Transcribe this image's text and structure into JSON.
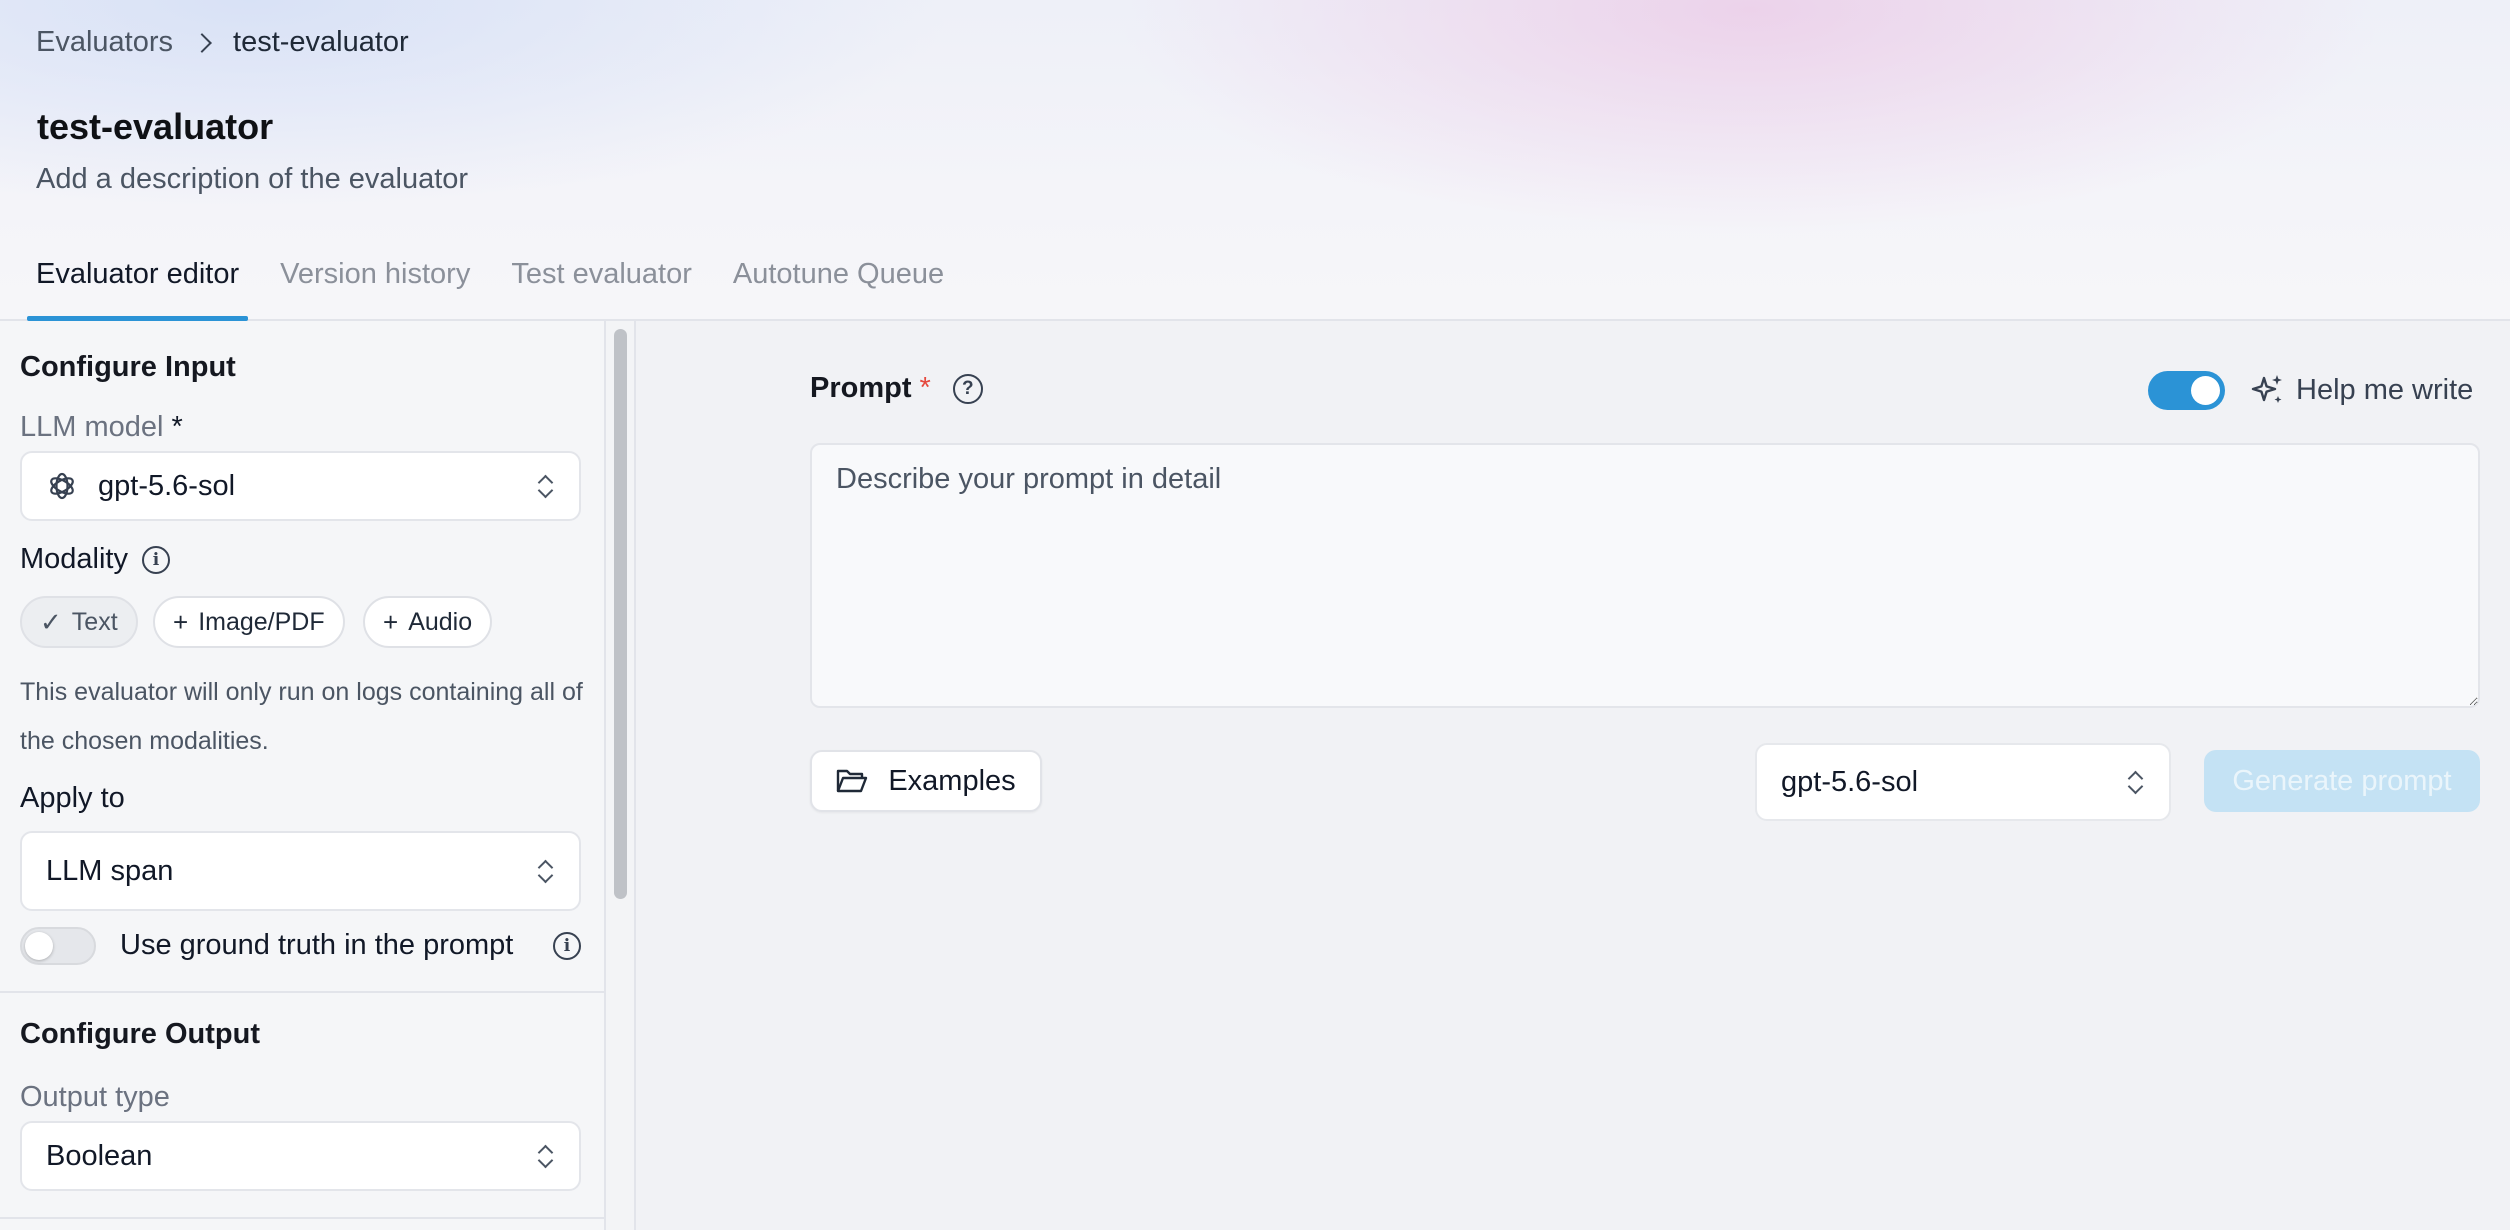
{
  "breadcrumb": {
    "root": "Evaluators",
    "current": "test-evaluator"
  },
  "page": {
    "title": "test-evaluator",
    "description": "Add a description of the evaluator"
  },
  "tabs": [
    {
      "label": "Evaluator editor",
      "active": true
    },
    {
      "label": "Version history",
      "active": false
    },
    {
      "label": "Test evaluator",
      "active": false
    },
    {
      "label": "Autotune Queue",
      "active": false
    }
  ],
  "configure_input": {
    "title": "Configure Input",
    "llm_model_label": "LLM model",
    "required_mark": "*",
    "llm_model_value": "gpt-5.6-sol",
    "llm_model_icon": "openai-icon",
    "modality_label": "Modality",
    "modalities": [
      {
        "label": "Text",
        "selected": true,
        "glyph": "✓"
      },
      {
        "label": "Image/PDF",
        "selected": false,
        "glyph": "+"
      },
      {
        "label": "Audio",
        "selected": false,
        "glyph": "+"
      }
    ],
    "modality_help": "This evaluator will only run on logs containing all of the chosen modalities.",
    "apply_to_label": "Apply to",
    "apply_to_value": "LLM span",
    "ground_truth_label": "Use ground truth in the prompt",
    "ground_truth_enabled": false
  },
  "configure_output": {
    "title": "Configure Output",
    "output_type_label": "Output type",
    "output_type_value": "Boolean"
  },
  "prompt": {
    "label": "Prompt",
    "required_mark": "*",
    "placeholder": "Describe your prompt in detail",
    "help_toggle_enabled": true,
    "help_me_write_label": "Help me write",
    "examples_label": "Examples",
    "model_value": "gpt-5.6-sol",
    "generate_label": "Generate prompt"
  },
  "colors": {
    "accent": "#2b93d6",
    "required": "#e5483d",
    "generate_disabled_bg": "#c4e2f4"
  }
}
